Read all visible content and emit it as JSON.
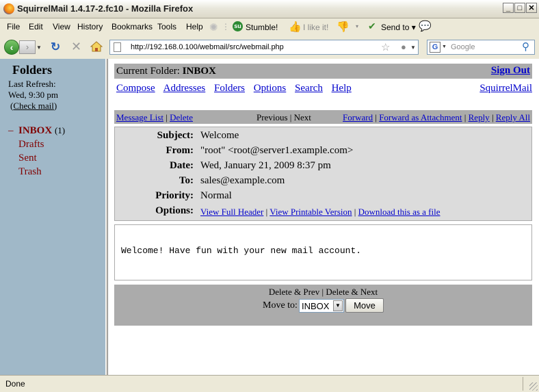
{
  "window": {
    "title": "SquirrelMail 1.4.17-2.fc10 - Mozilla Firefox",
    "min": "_",
    "max": "□",
    "close": "✕"
  },
  "menu": [
    "File",
    "Edit",
    "View",
    "History",
    "Bookmarks",
    "Tools",
    "Help"
  ],
  "toolbar": {
    "stumble": "Stumble!",
    "like": "I like it!",
    "send_to": "Send to"
  },
  "nav": {
    "url": "http://192.168.0.100/webmail/src/webmail.php",
    "search_placeholder": "Google"
  },
  "left": {
    "heading": "Folders",
    "last_refresh_label": "Last Refresh:",
    "last_refresh_time": "Wed, 9:30 pm",
    "check_mail": "Check mail",
    "folders": [
      {
        "name": "INBOX",
        "count": "(1)"
      },
      {
        "name": "Drafts"
      },
      {
        "name": "Sent"
      },
      {
        "name": "Trash"
      }
    ]
  },
  "right": {
    "current_folder_label": "Current Folder:",
    "current_folder": "INBOX",
    "sign_out": "Sign Out",
    "nav_links": [
      "Compose",
      "Addresses",
      "Folders",
      "Options",
      "Search",
      "Help"
    ],
    "brand": "SquirrelMail",
    "msgbar": {
      "message_list": "Message List",
      "delete": "Delete",
      "previous": "Previous",
      "next": "Next",
      "forward": "Forward",
      "forward_attachment": "Forward as Attachment",
      "reply": "Reply",
      "reply_all": "Reply All"
    },
    "headers": {
      "subject_label": "Subject:",
      "subject": "Welcome",
      "from_label": "From:",
      "from": "\"root\" <root@server1.example.com>",
      "date_label": "Date:",
      "date": "Wed, January 21, 2009 8:37 pm",
      "to_label": "To:",
      "to": "sales@example.com",
      "priority_label": "Priority:",
      "priority": "Normal",
      "options_label": "Options:",
      "view_full_header": "View Full Header",
      "view_printable": "View Printable Version",
      "download": "Download this as a file"
    },
    "body_text": "Welcome! Have fun with your new mail account.",
    "bottom": {
      "delete_prev": "Delete & Prev",
      "delete_next": "Delete & Next",
      "move_to_label": "Move to:",
      "move_selected": "INBOX",
      "move_button": "Move"
    }
  },
  "status": {
    "text": "Done"
  }
}
